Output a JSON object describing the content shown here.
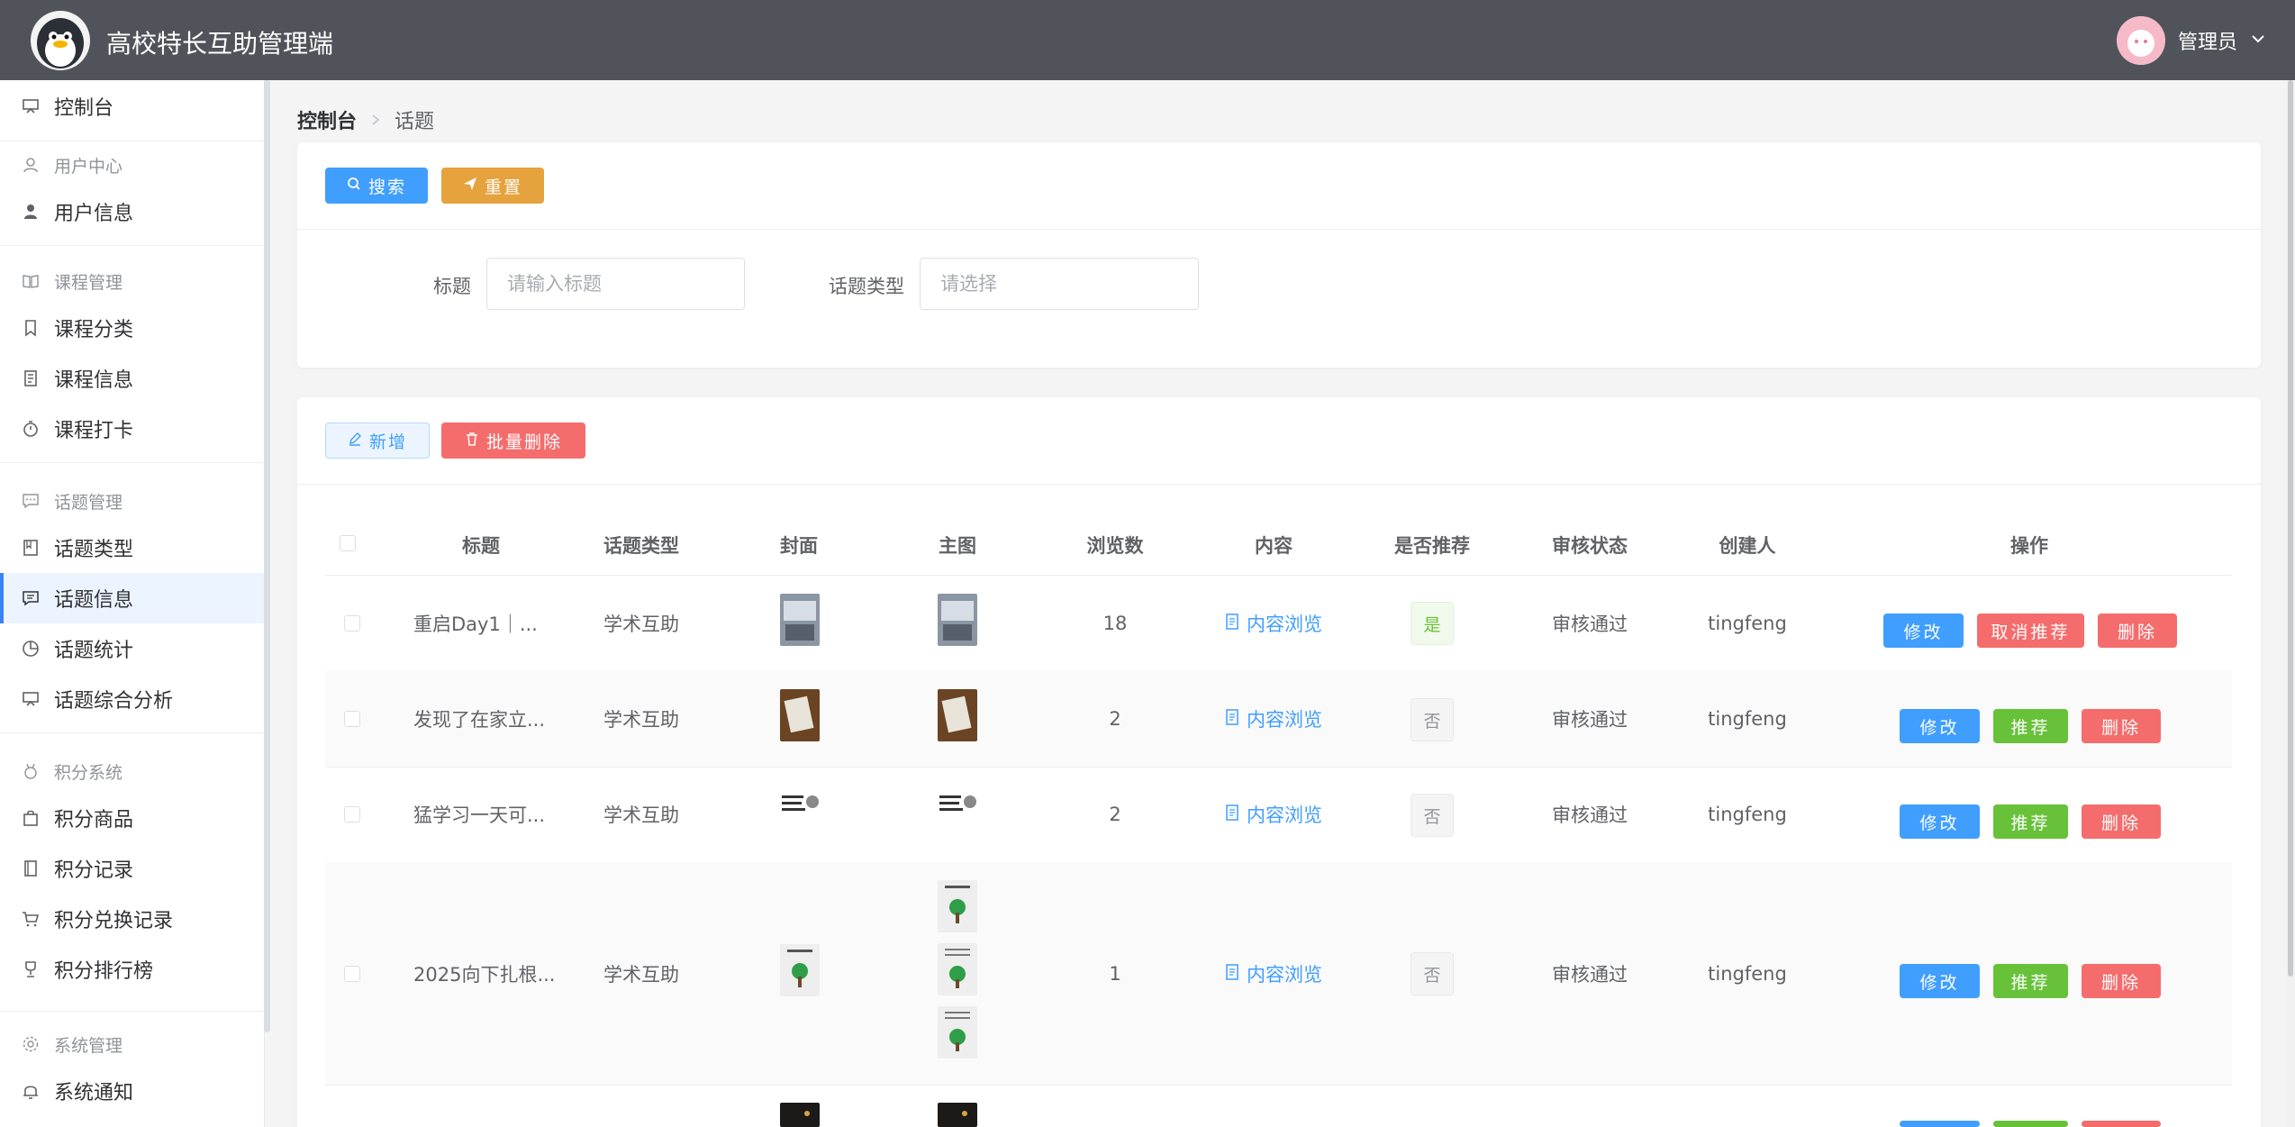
{
  "header": {
    "title": "高校特长互助管理端",
    "user": "管理员"
  },
  "sidebar": {
    "dashboard": "控制台",
    "groups": [
      {
        "title": "用户中心",
        "items": [
          "用户信息"
        ]
      },
      {
        "title": "课程管理",
        "items": [
          "课程分类",
          "课程信息",
          "课程打卡"
        ]
      },
      {
        "title": "话题管理",
        "items": [
          "话题类型",
          "话题信息",
          "话题统计",
          "话题综合分析"
        ]
      },
      {
        "title": "积分系统",
        "items": [
          "积分商品",
          "积分记录",
          "积分兑换记录",
          "积分排行榜"
        ]
      },
      {
        "title": "系统管理",
        "items": [
          "系统通知"
        ]
      }
    ],
    "active": "话题信息"
  },
  "breadcrumb": {
    "home": "控制台",
    "current": "话题"
  },
  "search": {
    "search_btn": "搜索",
    "reset_btn": "重置",
    "title_label": "标题",
    "title_placeholder": "请输入标题",
    "type_label": "话题类型",
    "type_placeholder": "请选择"
  },
  "toolbar": {
    "add_btn": "新增",
    "batch_delete_btn": "批量删除"
  },
  "table": {
    "columns": [
      "标题",
      "话题类型",
      "封面",
      "主图",
      "浏览数",
      "内容",
      "是否推荐",
      "审核状态",
      "创建人",
      "操作"
    ],
    "content_link": "内容浏览",
    "actions": {
      "edit": "修改",
      "recommend": "推荐",
      "unrecommend": "取消推荐",
      "delete": "删除"
    },
    "rows": [
      {
        "title": "重启Day1｜...",
        "type": "学术互助",
        "views": "18",
        "recommended": "是",
        "status": "审核通过",
        "creator": "tingfeng"
      },
      {
        "title": "发现了在家立...",
        "type": "学术互助",
        "views": "2",
        "recommended": "否",
        "status": "审核通过",
        "creator": "tingfeng"
      },
      {
        "title": "猛学习一天可...",
        "type": "学术互助",
        "views": "2",
        "recommended": "否",
        "status": "审核通过",
        "creator": "tingfeng"
      },
      {
        "title": "2025向下扎根...",
        "type": "学术互助",
        "views": "1",
        "recommended": "否",
        "status": "审核通过",
        "creator": "tingfeng"
      }
    ]
  },
  "colors": {
    "primary": "#409eff",
    "success": "#67c23a",
    "danger": "#f56c6c",
    "warning": "#e6a23c",
    "header": "#50545a"
  }
}
